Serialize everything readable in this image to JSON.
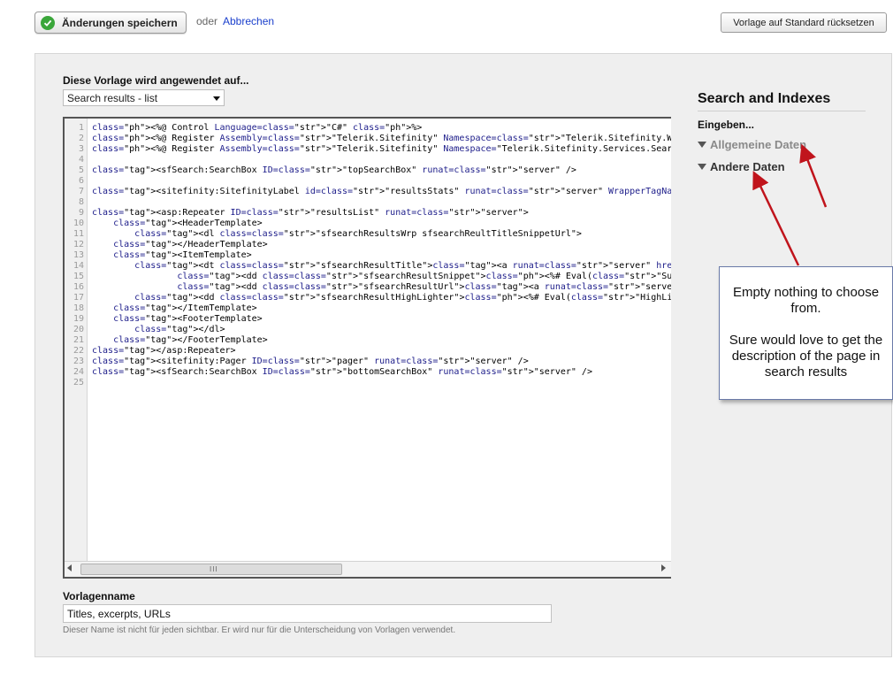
{
  "toolbar": {
    "save_label": "Änderungen speichern",
    "or_text": "oder",
    "cancel_label": "Abbrechen",
    "reset_label": "Vorlage auf Standard rücksetzen",
    "save_icon": "check-circle-icon"
  },
  "template": {
    "applies_label": "Diese Vorlage wird angewendet auf...",
    "applies_value": "Search results - list",
    "name_label": "Vorlagenname",
    "name_value": "Titles, excerpts, URLs",
    "name_hint": "Dieser Name ist nicht für jeden sichtbar. Er wird nur für die Unterscheidung von Vorlagen verwendet."
  },
  "editor": {
    "line_numbers": [
      "1",
      "2",
      "3",
      "4",
      "5",
      "6",
      "7",
      "8",
      "9",
      "10",
      "11",
      "12",
      "13",
      "14",
      "15",
      "16",
      "17",
      "18",
      "19",
      "20",
      "21",
      "22",
      "23",
      "24",
      "25"
    ],
    "scroll_grip": "III",
    "lines": [
      "<%@ Control Language=\"C#\" %>",
      "<%@ Register Assembly=\"Telerik.Sitefinity\" Namespace=\"Telerik.Sitefinity.Web.UI\" TagPrefix=\"si",
      "<%@ Register Assembly=\"Telerik.Sitefinity\" Namespace=\"Telerik.Sitefinity.Services.Search.Web.U",
      "",
      "<sfSearch:SearchBox ID=\"topSearchBox\" runat=\"server\" />",
      "",
      "<sitefinity:SitefinityLabel id=\"resultsStats\" runat=\"server\" WrapperTagName=\"p\" CssClass=\"sfse",
      "",
      "<asp:Repeater ID=\"resultsList\" runat=\"server\">",
      "    <HeaderTemplate>",
      "        <dl class=\"sfsearchResultsWrp sfsearchReultTitleSnippetUrl\">",
      "    </HeaderTemplate>",
      "    <ItemTemplate>",
      "        <dt class=\"sfsearchResultTitle\"><a runat=\"server\" href='<%# Eval(\"Link\")%>'><%# Eval(\"",
      "                <dd class=\"sfsearchResultSnippet\"><%# Eval(\"Summary\")%></dd>",
      "                <dd class=\"sfsearchResultUrl\"><a runat=\"server\"  href='<%# Eval(\"Link\")%>'><%#",
      "        <dd class=\"sfsearchResultHighLighter\"><%# Eval(\"HighLighterResult\")%></dd>",
      "    </ItemTemplate>",
      "    <FooterTemplate>",
      "        </dl>",
      "    </FooterTemplate>",
      "</asp:Repeater>",
      "<sitefinity:Pager ID=\"pager\" runat=\"server\" />",
      "<sfSearch:SearchBox ID=\"bottomSearchBox\" runat=\"server\" />",
      ""
    ]
  },
  "sidebar": {
    "title": "Search and Indexes",
    "enter_label": "Eingeben...",
    "general_data": "Allgemeine Daten",
    "other_data": "Andere Daten"
  },
  "annotation": {
    "line1": "Empty nothing to choose from.",
    "line2": "Sure would love to get the description of the page in search results",
    "arrow_color": "#c0141c"
  }
}
